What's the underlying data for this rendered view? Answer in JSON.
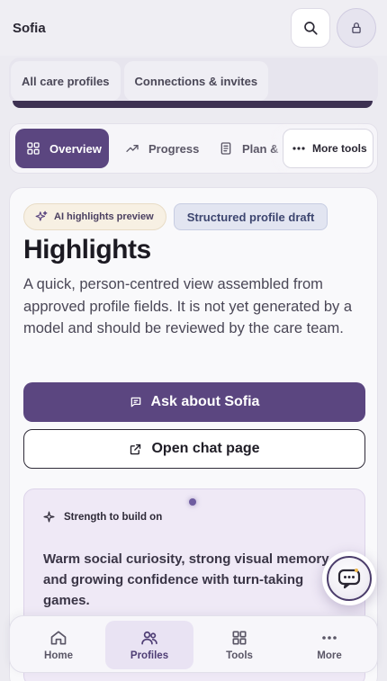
{
  "header": {
    "title": "Sofia",
    "search_icon": "search-icon",
    "lock_icon": "lock-icon"
  },
  "top_tabs": [
    {
      "label": "All care profiles"
    },
    {
      "label": "Connections & invites"
    }
  ],
  "tool_tabs": {
    "overview": "Overview",
    "progress": "Progress",
    "plan": "Plan &",
    "more_tools": "More tools",
    "active": "Overview"
  },
  "card": {
    "badge_ai": "AI highlights preview",
    "badge_draft": "Structured profile draft",
    "heading": "Highlights",
    "description": "A quick, person-centred view assembled from approved profile fields. It is not yet generated by a model and should be reviewed by the care team.",
    "ask_button": "Ask about Sofia",
    "open_chat_button": "Open chat page",
    "strength": {
      "label": "Strength to build on",
      "text": "Warm social curiosity, strong visual memory, and growing confidence with turn-taking games."
    }
  },
  "bottom_nav": {
    "items": [
      {
        "label": "Home",
        "icon": "home-icon"
      },
      {
        "label": "Profiles",
        "icon": "profiles-icon"
      },
      {
        "label": "Tools",
        "icon": "grid-icon"
      },
      {
        "label": "More",
        "icon": "more-icon"
      }
    ],
    "active": "Profiles"
  },
  "colors": {
    "accent": "#5b4680",
    "background": "#ecebf1"
  }
}
